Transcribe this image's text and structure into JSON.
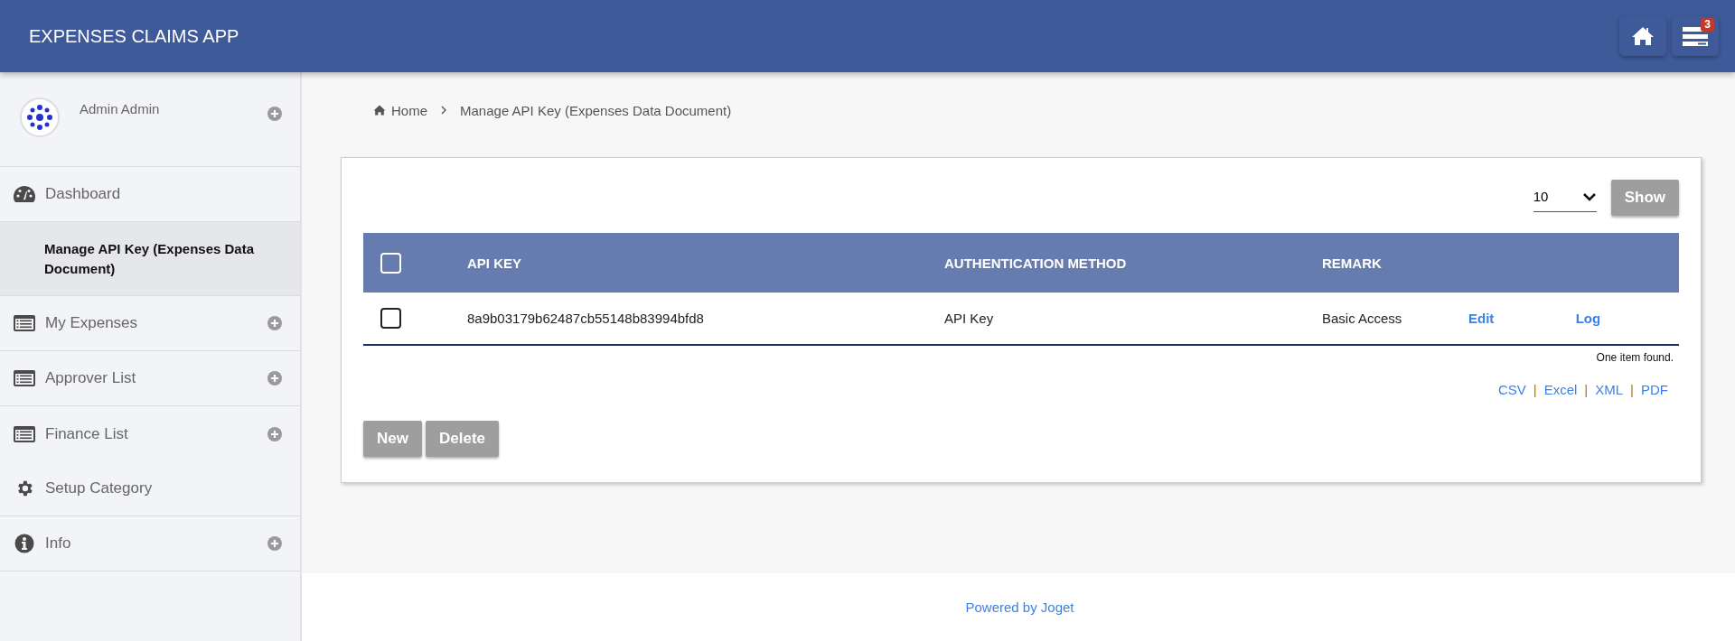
{
  "header": {
    "title": "EXPENSES CLAIMS APP",
    "badge": "3"
  },
  "sidebar": {
    "user": "Admin Admin",
    "items": [
      {
        "label": "Dashboard",
        "kind": "gauge",
        "expandable": false,
        "selected": false
      },
      {
        "label": "Manage API Key (Expenses Data Document)",
        "kind": "sub",
        "expandable": false,
        "selected": true
      },
      {
        "label": "My Expenses",
        "kind": "list",
        "expandable": true,
        "selected": false
      },
      {
        "label": "Approver List",
        "kind": "list",
        "expandable": true,
        "selected": false
      },
      {
        "label": "Finance List",
        "kind": "list",
        "expandable": true,
        "selected": false
      },
      {
        "label": "Setup Category",
        "kind": "gear",
        "expandable": false,
        "selected": false
      },
      {
        "label": "Info",
        "kind": "info",
        "expandable": true,
        "selected": false
      }
    ]
  },
  "breadcrumb": [
    "Home",
    "Manage API Key (Expenses Data Document)"
  ],
  "page_size": {
    "value": "10"
  },
  "show_button": "Show",
  "table": {
    "header_checked": false,
    "columns": [
      "API KEY",
      "AUTHENTICATION METHOD",
      "REMARK"
    ],
    "rows": [
      {
        "checked": false,
        "cells": [
          "8a9b03179b62487cb55148b83994bfd8",
          "API Key",
          "Basic Access"
        ],
        "actions": [
          "Edit",
          "Log"
        ]
      }
    ]
  },
  "summary": "One item found.",
  "exports": [
    {
      "label": "CSV",
      "separator": "|"
    },
    {
      "label": "Excel",
      "separator": "|"
    },
    {
      "label": "XML",
      "separator": "|"
    },
    {
      "label": "PDF"
    }
  ],
  "buttons": [
    "New",
    "Delete"
  ],
  "footer": "Powered by Joget"
}
